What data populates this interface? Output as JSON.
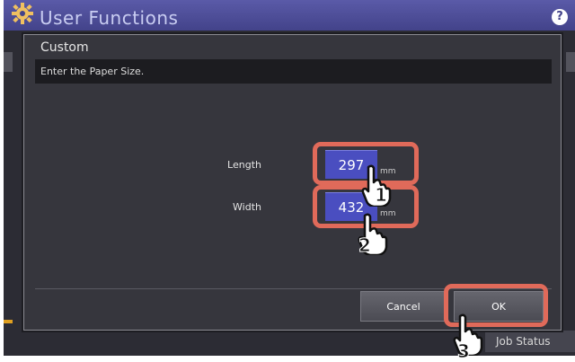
{
  "header": {
    "title": "User Functions",
    "help_label": "?"
  },
  "dialog": {
    "title": "Custom",
    "message": "Enter the Paper Size.",
    "length": {
      "label": "Length",
      "value": "297",
      "unit": "mm"
    },
    "width": {
      "label": "Width",
      "value": "432",
      "unit": "mm"
    },
    "cancel_label": "Cancel",
    "ok_label": "OK"
  },
  "footer": {
    "job_status_label": "Job Status"
  },
  "steps": [
    "1",
    "2",
    "3"
  ],
  "colors": {
    "header": "#43438a",
    "value_field": "#4a4ec0",
    "highlight": "#e06a5a",
    "dialog_bg": "#36363d"
  }
}
